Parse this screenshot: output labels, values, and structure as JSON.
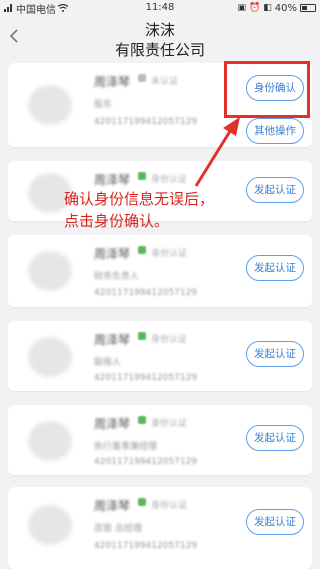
{
  "status": {
    "carrier": "中国电信",
    "time": "11:48",
    "battery": "40%"
  },
  "header": {
    "back_icon": "chevron-left-icon",
    "title_line1": "沫沫",
    "title_line2": "有限责任公司"
  },
  "members": [
    {
      "name": "周泽琴",
      "auth": "未认证",
      "role": "股东",
      "id": "420117199412057129",
      "primary": "身份确认",
      "secondary": "其他操作"
    },
    {
      "name": "周泽琴",
      "auth": "身份认证",
      "role": "",
      "id": "",
      "primary": "发起认证"
    },
    {
      "name": "周泽琴",
      "auth": "身份认证",
      "role": "财务负责人",
      "id": "420117199412057129",
      "primary": "发起认证"
    },
    {
      "name": "周泽琴",
      "auth": "身份认证",
      "role": "联络人",
      "id": "420117199412057129",
      "primary": "发起认证"
    },
    {
      "name": "周泽琴",
      "auth": "身份认证",
      "role": "执行董事兼经理",
      "id": "420117199412057129",
      "primary": "发起认证"
    },
    {
      "name": "周泽琴",
      "auth": "身份认证",
      "role": "高管 总经理",
      "id": "420117199412057129",
      "primary": "发起认证"
    }
  ],
  "annotation": {
    "line1": "确认身份信息无误后，",
    "line2": "点击身份确认。",
    "color": "#e3302a"
  }
}
